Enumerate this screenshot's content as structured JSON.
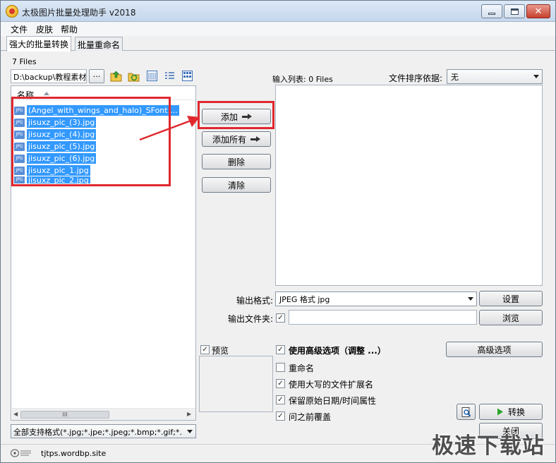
{
  "window": {
    "title": "太极图片批量处理助手  v2018"
  },
  "menu": [
    "文件",
    "皮肤",
    "帮助"
  ],
  "tabs": [
    "强大的批量转换",
    "批量重命名"
  ],
  "browser": {
    "file_count": "7 Files",
    "path": "D:\\backup\\教程素材",
    "browse_label": "...",
    "column_name": "名称",
    "files": [
      "(Angel_with_wings_and_halo)_SFont....",
      "jisuxz_pic_(3).jpg",
      "jisuxz_pic_(4).jpg",
      "jisuxz_pic_(5).jpg",
      "jisuxz_pic_(6).jpg",
      "jisuxz_pic_1.jpg",
      "jisuxz_pic_2.jpg"
    ],
    "file_icon": "JPG",
    "scroll_thumb": "III",
    "filter": "全部支持格式(*.jpg;*.jpe;*.jpeg;*.bmp;*.gif;*."
  },
  "actions": {
    "add": "添加",
    "add_all": "添加所有",
    "delete": "删除",
    "clear": "清除"
  },
  "input_list": {
    "label": "输入列表: 0 Files",
    "sort_label": "文件排序依据:",
    "sort_value": "无"
  },
  "output": {
    "format_label": "输出格式:",
    "format_value": "JPEG 格式 jpg",
    "settings": "设置",
    "folder_label": "输出文件夹:",
    "browse": "浏览"
  },
  "options": {
    "preview": "预览",
    "advanced_options": "使用高级选项（调整 ...）",
    "advanced_button": "高级选项",
    "rename": "重命名",
    "uppercase_ext": "使用大写的文件扩展名",
    "keep_date": "保留原始日期/时间属性",
    "overwrite": "问之前覆盖"
  },
  "buttons": {
    "convert": "转换",
    "close": "关闭"
  },
  "status": {
    "site": "tjtps.wordbp.site"
  },
  "watermark": "极速下载站",
  "colors": {
    "selection": "#3399ff",
    "annotation": "#e0282e"
  }
}
